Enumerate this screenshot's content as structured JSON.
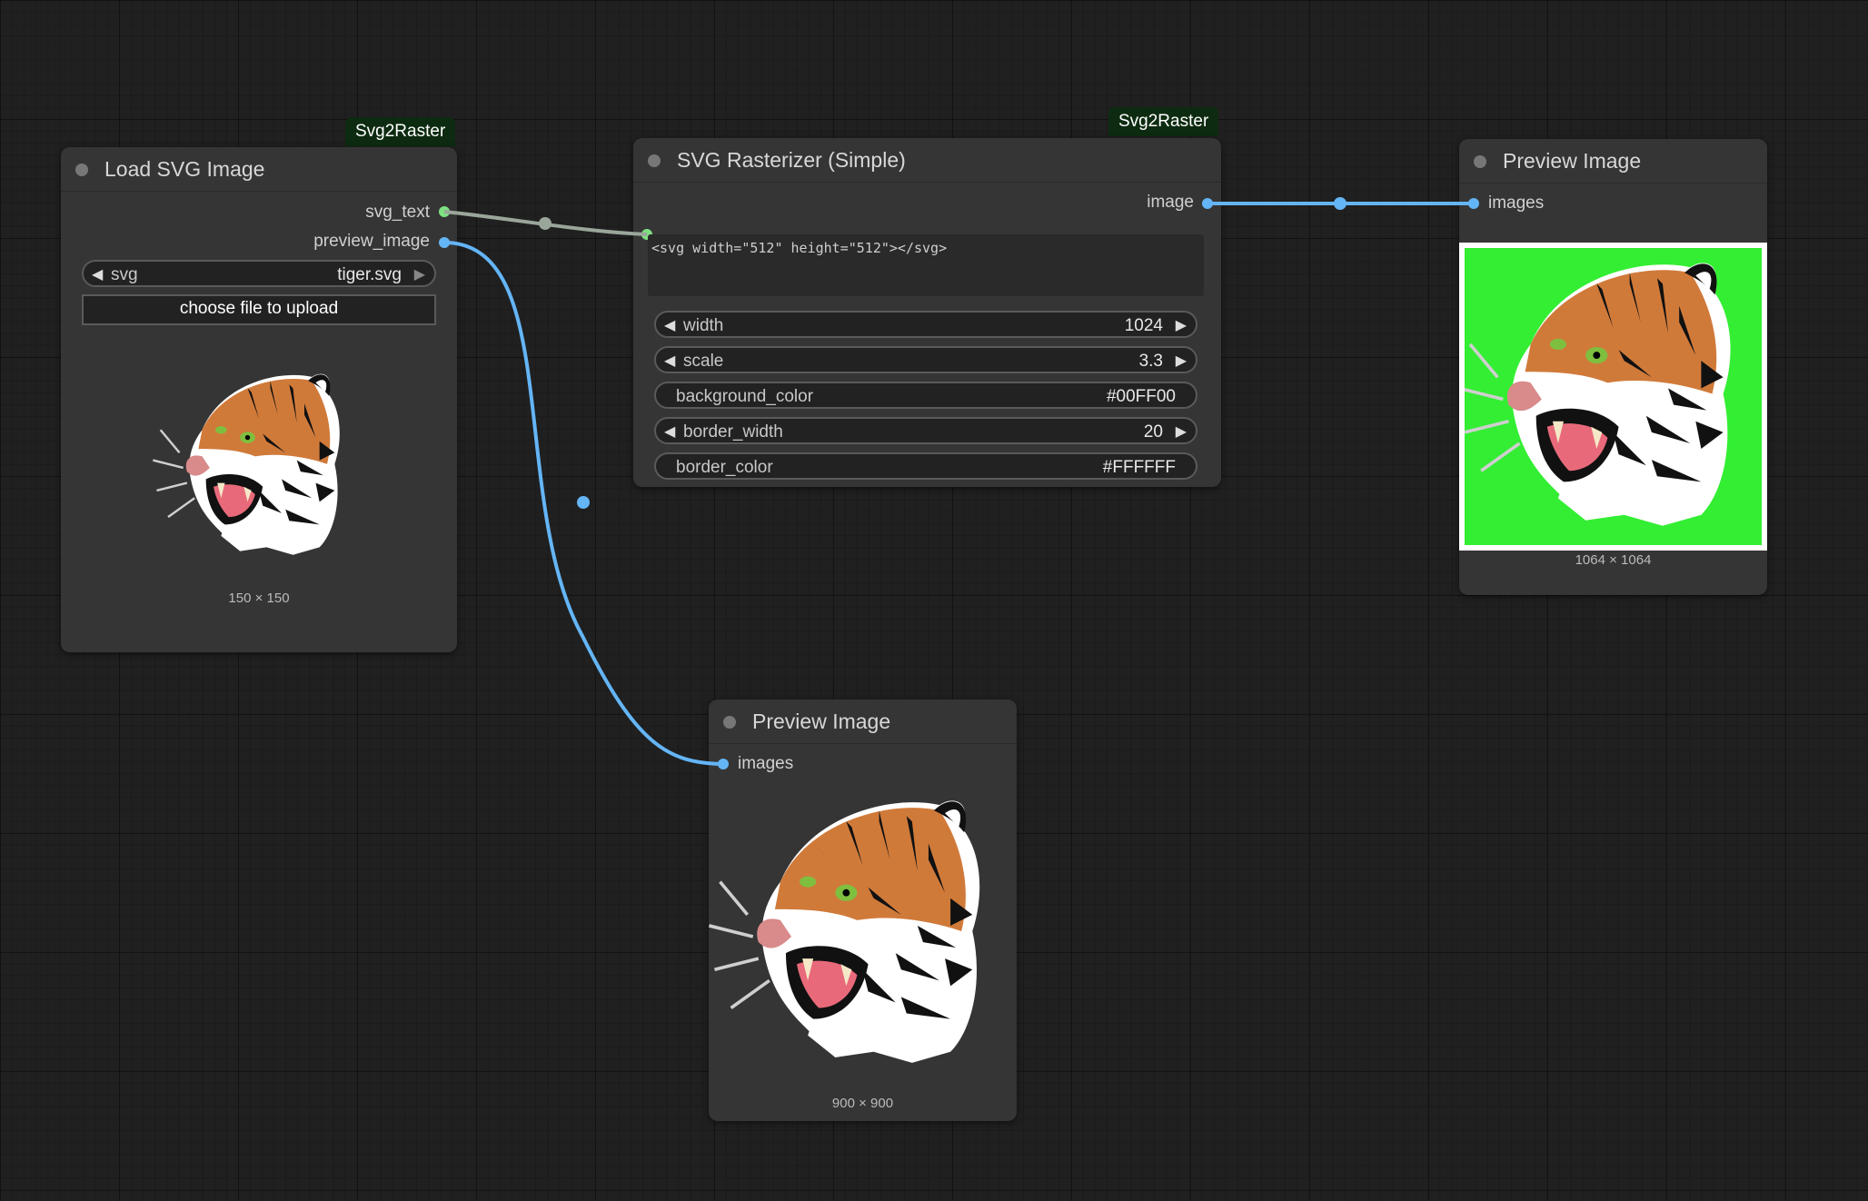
{
  "nodes": {
    "load_svg": {
      "badge": "Svg2Raster",
      "title": "Load SVG Image",
      "outputs": [
        "svg_text",
        "preview_image"
      ],
      "svg_widget": {
        "name": "svg",
        "value": "tiger.svg"
      },
      "upload_label": "choose file to upload",
      "image_size": "150 × 150"
    },
    "rasterizer": {
      "badge": "Svg2Raster",
      "title": "SVG Rasterizer (Simple)",
      "output": "image",
      "svg_text": "<svg width=\"512\" height=\"512\"></svg>",
      "widgets": {
        "width": {
          "name": "width",
          "value": "1024"
        },
        "scale": {
          "name": "scale",
          "value": "3.3"
        },
        "background_color": {
          "name": "background_color",
          "value": "#00FF00"
        },
        "border_width": {
          "name": "border_width",
          "value": "20"
        },
        "border_color": {
          "name": "border_color",
          "value": "#FFFFFF"
        }
      }
    },
    "preview_top": {
      "title": "Preview Image",
      "input": "images",
      "image_size": "1064 × 1064"
    },
    "preview_bottom": {
      "title": "Preview Image",
      "input": "images",
      "image_size": "900 × 900"
    }
  },
  "colors": {
    "canvas": "#202020",
    "node": "#353535",
    "badge": "#0d2b10",
    "string_link": "#9aa69a",
    "image_link": "#64b5f6",
    "preview_background": "#33ee33"
  },
  "icons": [
    "arrow-left-icon",
    "arrow-right-icon",
    "tiger-illustration"
  ]
}
